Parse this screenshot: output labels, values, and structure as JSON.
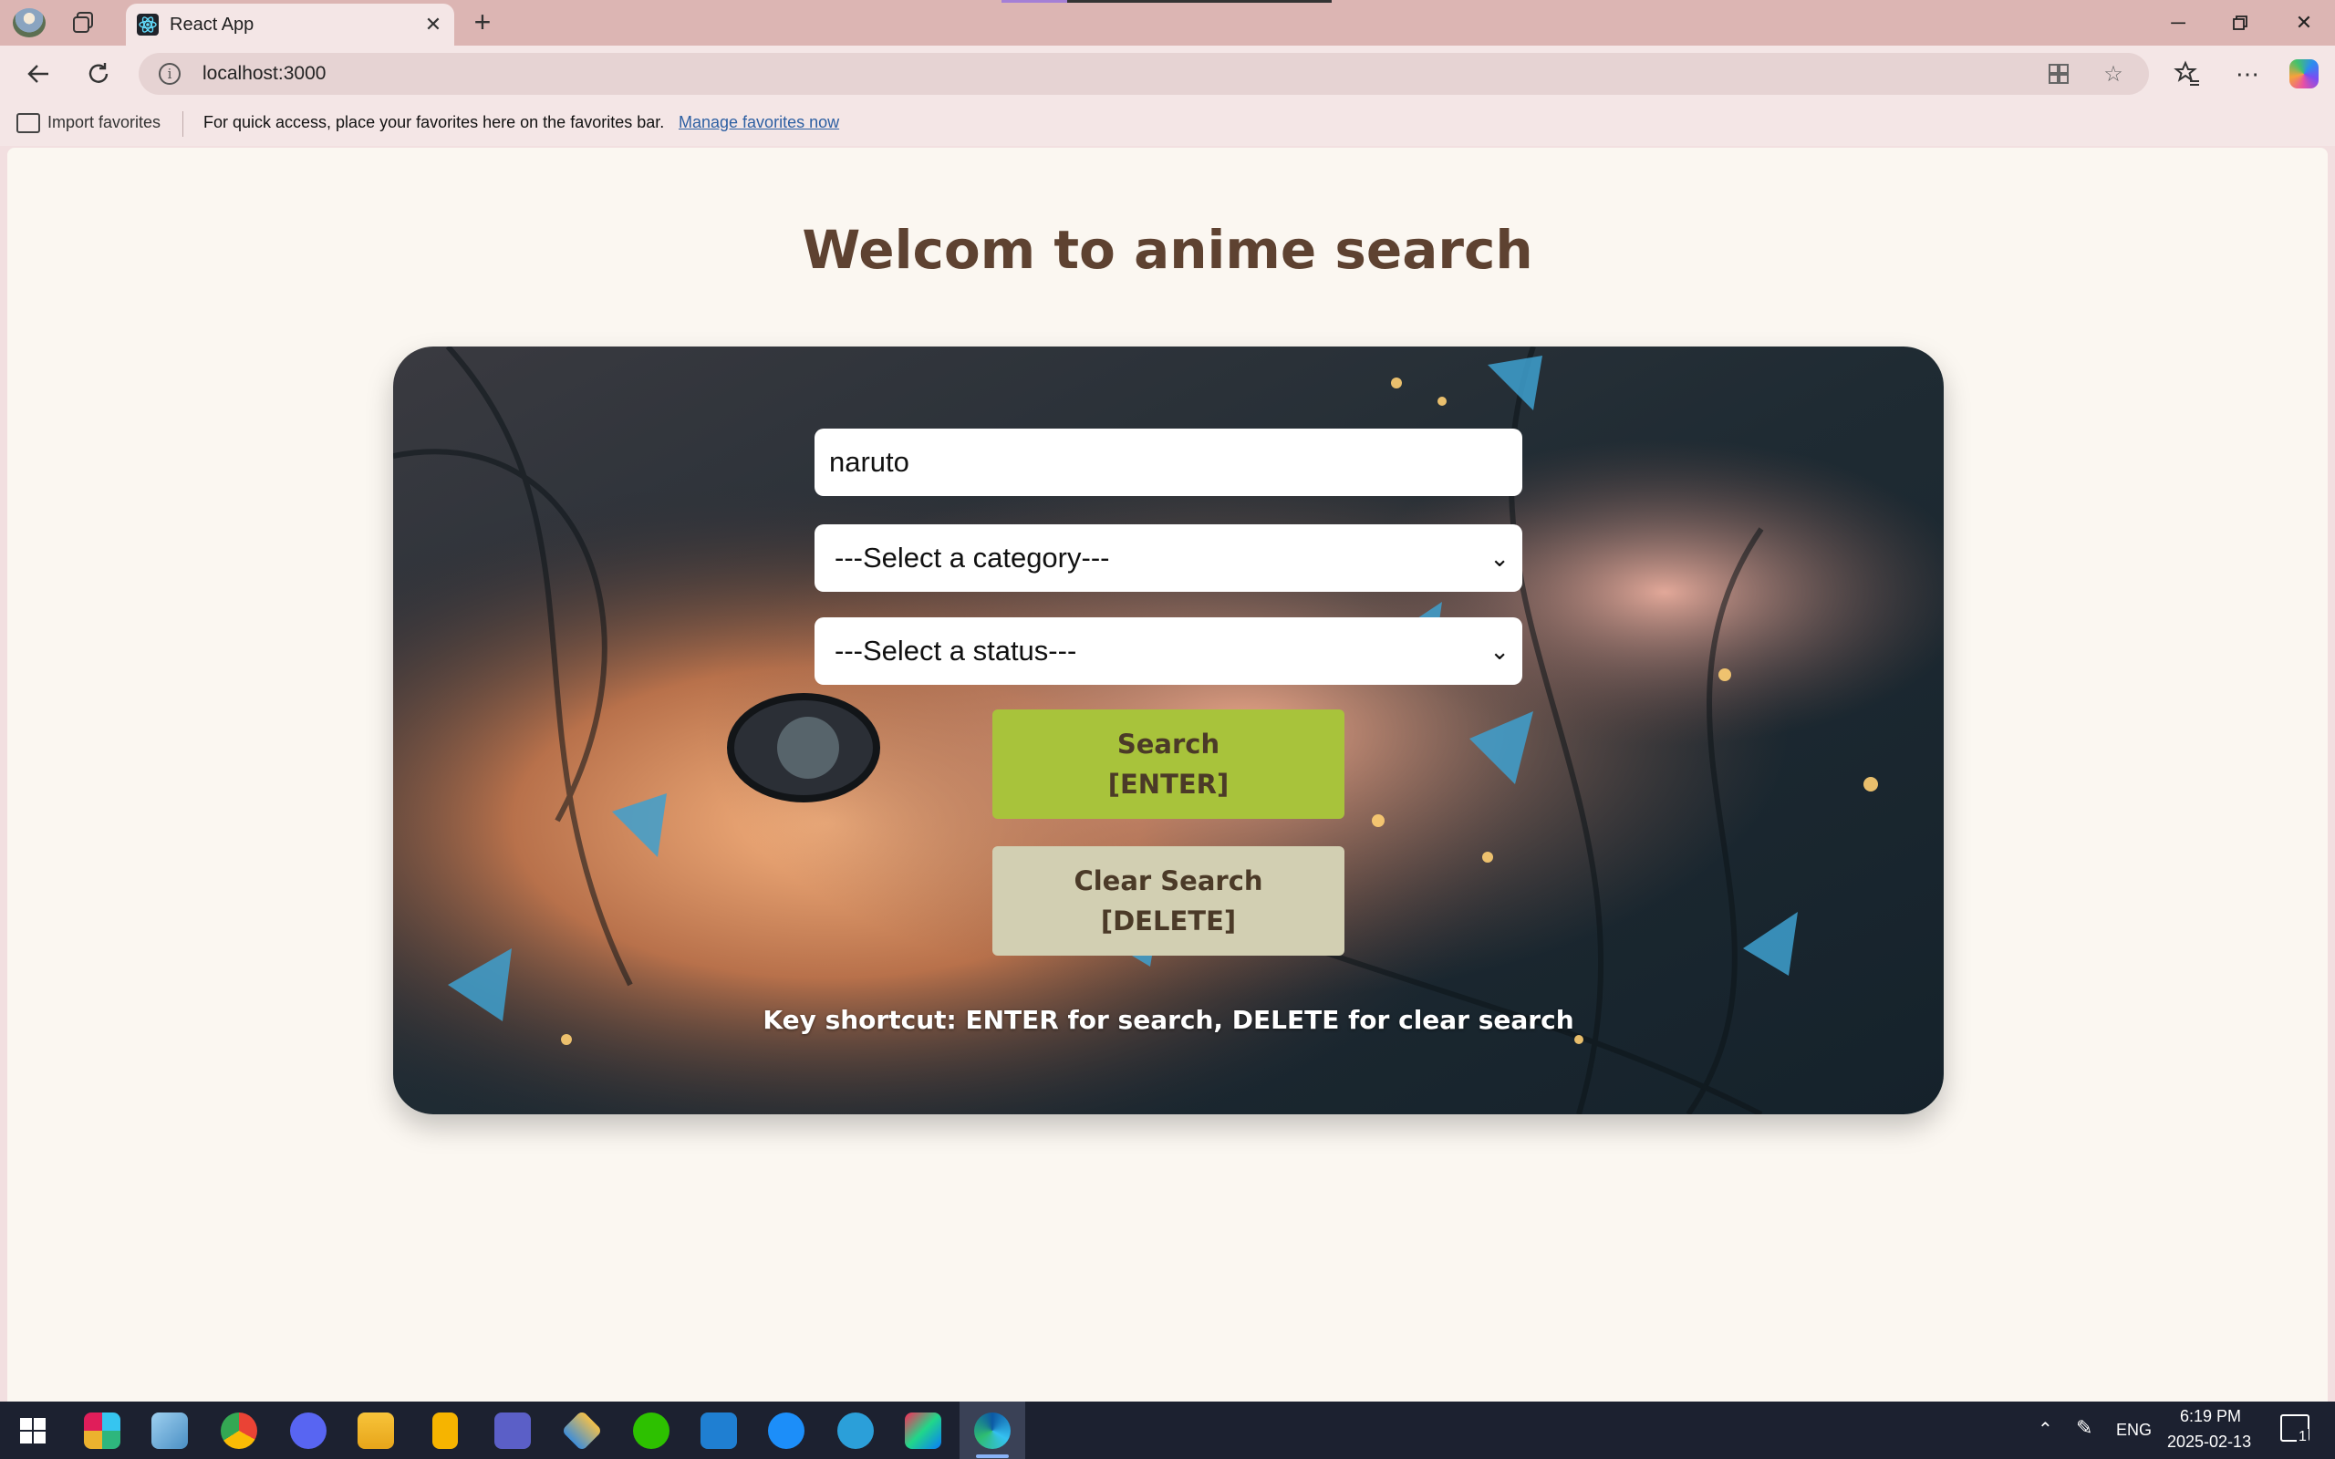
{
  "browser": {
    "tab_title": "React App",
    "url": "localhost:3000",
    "favorites_bar": {
      "import_label": "Import favorites",
      "message": "For quick access, place your favorites here on the favorites bar.",
      "manage_link": "Manage favorites now"
    }
  },
  "page": {
    "title": "Welcom to anime search",
    "search": {
      "value": "naruto"
    },
    "category_select": {
      "selected": "---Select a category---"
    },
    "status_select": {
      "selected": "---Select a status---"
    },
    "search_button": {
      "line1": "Search",
      "line2": "[ENTER]"
    },
    "clear_button": {
      "line1": "Clear Search",
      "line2": "[DELETE]"
    },
    "shortcut_hint": "Key shortcut: ENTER for search, DELETE for clear search"
  },
  "taskbar": {
    "language": "ENG",
    "time": "6:19 PM",
    "date": "2025-02-13",
    "notification_count": "1",
    "apps": [
      "start-icon",
      "slack-icon",
      "notepad-icon",
      "chrome-icon",
      "discord-icon",
      "file-explorer-icon",
      "keep-icon",
      "teams-icon",
      "sourcetree-icon",
      "wechat-icon",
      "vscode-icon",
      "app-store-icon",
      "notes-icon",
      "intellij-icon",
      "edge-icon"
    ]
  },
  "colors": {
    "title_text": "#5e4231",
    "search_button": "#a8c33b",
    "clear_button": "#d2cfb2",
    "page_bg": "#fbf7f1",
    "browser_frame": "#dcb5b3"
  }
}
